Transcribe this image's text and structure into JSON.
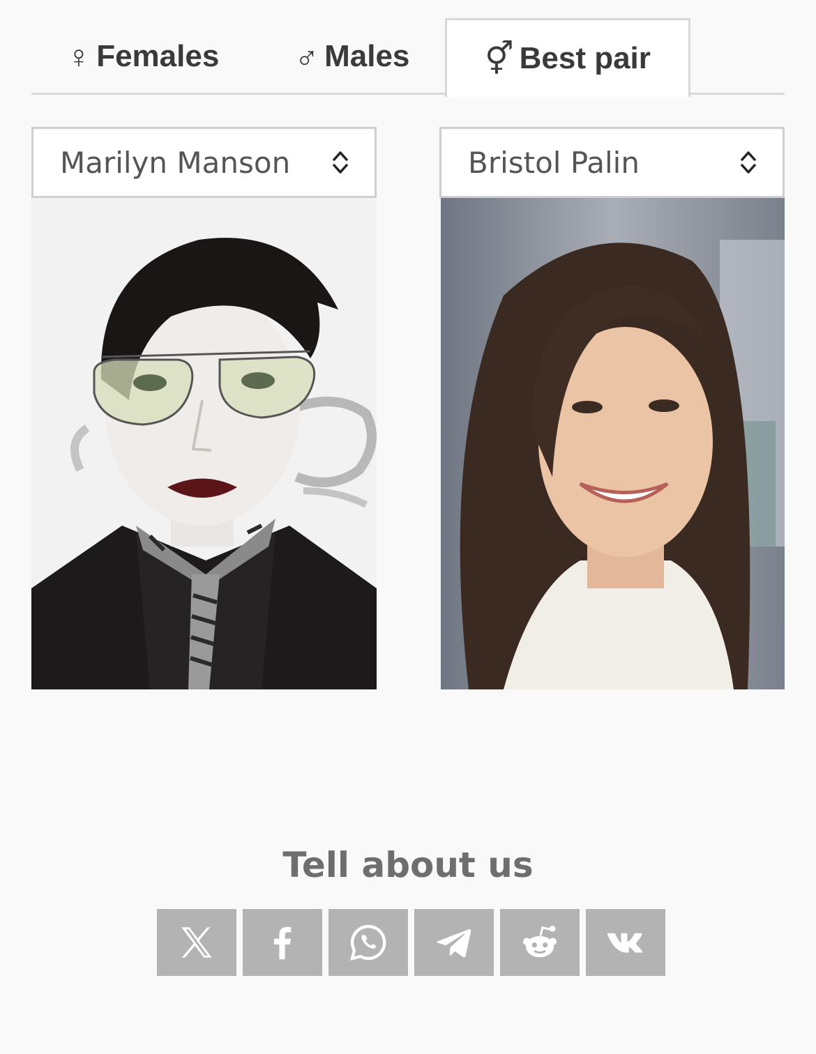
{
  "tabs": [
    {
      "symbol": "♀",
      "label": "Females",
      "active": false
    },
    {
      "symbol": "♂",
      "label": "Males",
      "active": false
    },
    {
      "symbol": "⚥",
      "label": "Best pair",
      "active": true
    }
  ],
  "selects": {
    "left": {
      "value": "Marilyn Manson"
    },
    "right": {
      "value": "Bristol Palin"
    }
  },
  "photos": {
    "left": {
      "alt": "Marilyn Manson"
    },
    "right": {
      "alt": "Bristol Palin"
    }
  },
  "share": {
    "title": "Tell about us",
    "buttons": [
      {
        "icon": "x-icon"
      },
      {
        "icon": "facebook-icon"
      },
      {
        "icon": "whatsapp-icon"
      },
      {
        "icon": "telegram-icon"
      },
      {
        "icon": "reddit-icon"
      },
      {
        "icon": "vk-icon"
      }
    ]
  },
  "colors": {
    "background": "#f9f9f9",
    "share_button": "#b3b3b3",
    "share_title": "#6e6e6e"
  }
}
